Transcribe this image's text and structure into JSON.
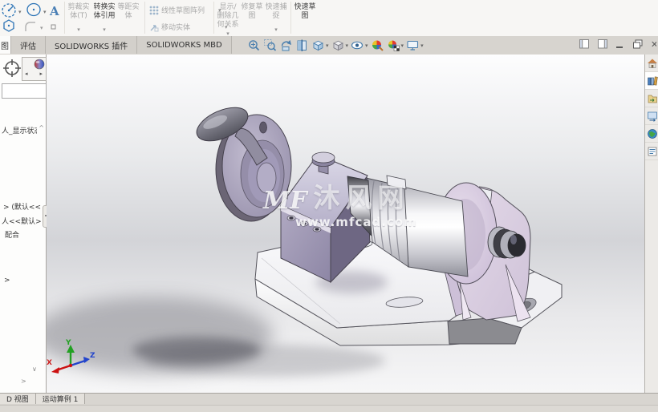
{
  "ribbon": {
    "sketch_tools": {
      "text_tool_glyph": "A"
    },
    "dropdown_glyph": "▾",
    "buttons": [
      {
        "label": "剪裁实体(T)",
        "enabled": false,
        "dropdown": true
      },
      {
        "label": "转换实体引用",
        "enabled": true,
        "dropdown": true
      },
      {
        "label": "等距实体",
        "enabled": false,
        "dropdown": false
      },
      {
        "label": "线性草图阵列",
        "enabled": false,
        "dropdown": true
      },
      {
        "label": "移动实体",
        "enabled": false,
        "dropdown": true
      },
      {
        "label": "显示/删除几何关系",
        "enabled": false,
        "dropdown": true
      },
      {
        "label": "修复草图",
        "enabled": false,
        "dropdown": false
      },
      {
        "label": "快速捕捉",
        "enabled": false,
        "dropdown": true
      },
      {
        "label": "快速草图",
        "enabled": true,
        "dropdown": false
      }
    ]
  },
  "command_tabs": {
    "partial_tab": "图",
    "tabs": [
      "评估",
      "SOLIDWORKS 插件",
      "SOLIDWORKS MBD"
    ]
  },
  "heads_up_icons": [
    "zoom-to-fit",
    "zoom-to-area",
    "previous-view",
    "section-view",
    "view-orientation",
    "display-style",
    "hide-show-items",
    "edit-appearance",
    "apply-scene",
    "view-settings"
  ],
  "window_controls": [
    "collapse-panel-left",
    "collapse-panel-right",
    "minimize",
    "restore",
    "close"
  ],
  "feature_tree": {
    "search_value": "",
    "items": [
      "人_显示状态",
      "> (默认<<",
      "人<<默认>",
      "配合",
      ">"
    ]
  },
  "task_pane_icons": [
    "home",
    "design-library",
    "file-explorer",
    "view-palette",
    "appearances-scenes",
    "custom-properties"
  ],
  "viewport": {
    "watermark": {
      "logo": "MF",
      "brand": "沐风网",
      "url": "www.mfcad.com"
    },
    "triad": {
      "x": "X",
      "y": "Y",
      "z": "Z"
    }
  },
  "bottom_bar": {
    "tabs": [
      "D 视图",
      "运动算例 1"
    ]
  },
  "colors": {
    "tool_blue": "#2a72b5",
    "model_purple": "#9a93b0",
    "model_pink": "#dccfe2",
    "base_white": "#f4f4f6",
    "viewport_gray": "#d3d4d8"
  }
}
